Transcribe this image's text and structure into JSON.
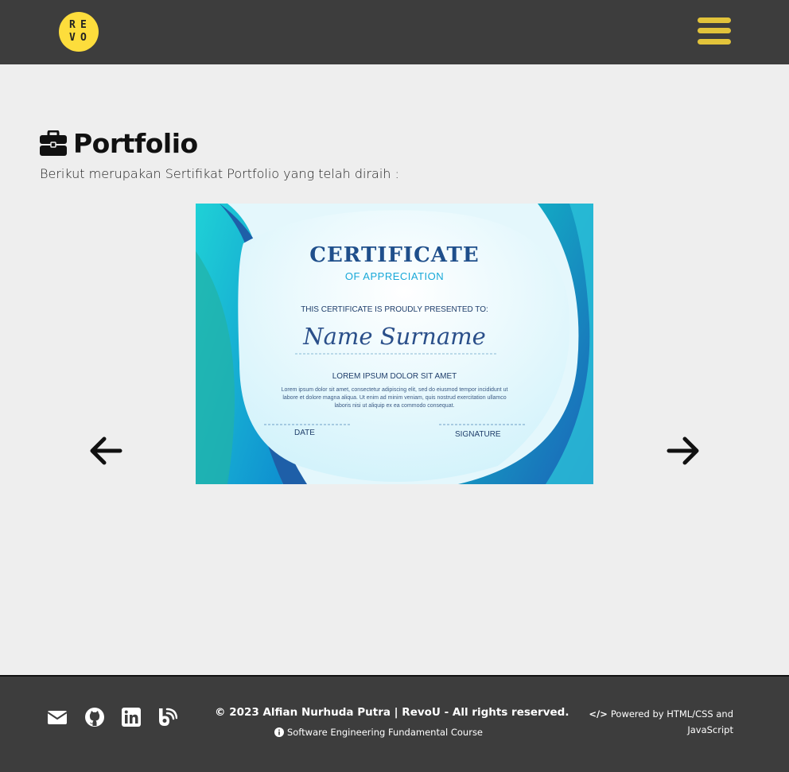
{
  "header": {
    "logo_letters": [
      "R",
      "E",
      "V",
      "O"
    ],
    "menu_icon": "hamburger-icon",
    "accent_color": "#e2c33a"
  },
  "main": {
    "title_icon": "briefcase-icon",
    "title": "Portfolio",
    "subtitle": "Berikut merupakan Sertifikat Portfolio yang telah diraih :",
    "carousel": {
      "prev_icon": "arrow-left-icon",
      "next_icon": "arrow-right-icon",
      "certificate": {
        "title": "CERTIFICATE",
        "subtitle": "OF APPRECIATION",
        "presented": "THIS CERTIFICATE IS PROUDLY PRESENTED TO:",
        "name": "Name Surname",
        "heading": "LOREM IPSUM DOLOR SIT AMET",
        "body": "Lorem ipsum dolor sit amet, consectetur adipiscing elit, sed do eiusmod tempor incididunt ut labore et dolore magna aliqua. Ut enim ad minim veniam, quis nostrud exercitation ullamco laboris nisi ut aliquip ex ea commodo consequat.",
        "date_label": "DATE",
        "signature_label": "SIGNATURE"
      }
    }
  },
  "footer": {
    "social_icons": [
      "envelope-icon",
      "github-icon",
      "linkedin-icon",
      "blog-icon"
    ],
    "copyright": "© 2023 Alfian Nurhuda Putra | RevoU - All rights reserved.",
    "course": "Software Engineering Fundamental Course",
    "powered_prefix": "</>",
    "powered_line1": "Powered by HTML/CSS and",
    "powered_line2": "JavaScript"
  },
  "colors": {
    "header_bg": "#3d3d3d",
    "page_bg": "#eeeeee",
    "logo_bg": "#fddd3c"
  }
}
